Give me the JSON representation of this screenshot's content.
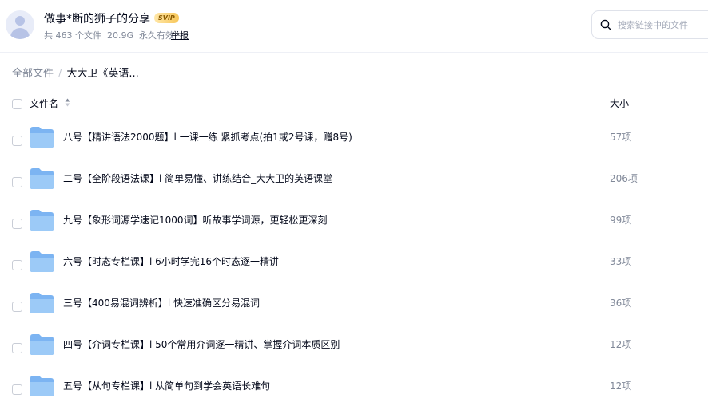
{
  "share": {
    "title": "做事*断的狮子的分享",
    "badge": "SVIP",
    "file_count": "共 463 个文件",
    "total_size": "20.9G",
    "validity": "永久有效",
    "report": "举报"
  },
  "search": {
    "placeholder": "搜索链接中的文件"
  },
  "breadcrumb": {
    "root": "全部文件",
    "separator": "/",
    "current": "大大卫《英语..."
  },
  "columns": {
    "name": "文件名",
    "size": "大小"
  },
  "files": [
    {
      "name": "八号【精讲语法2000题】l 一课一练 紧抓考点(拍1或2号课，赠8号)",
      "size": "57项"
    },
    {
      "name": "二号【全阶段语法课】l 简单易懂、讲练结合_大大卫的英语课堂",
      "size": "206项"
    },
    {
      "name": "九号【象形词源学速记1000词】听故事学词源，更轻松更深刻",
      "size": "99项"
    },
    {
      "name": "六号【时态专栏课】l 6小时学完16个时态逐一精讲",
      "size": "33项"
    },
    {
      "name": "三号【400易混词辨析】l 快速准确区分易混词",
      "size": "36项"
    },
    {
      "name": "四号【介词专栏课】l 50个常用介词逐一精讲、掌握介词本质区别",
      "size": "12项"
    },
    {
      "name": "五号【从句专栏课】l 从简单句到学会英语长难句",
      "size": "12项"
    }
  ],
  "icons": {
    "avatar": "avatar-icon",
    "search": "search-icon",
    "sort": "sort-icon",
    "folder": "folder-icon"
  },
  "colors": {
    "text": "#03081a",
    "secondary": "#818999",
    "folder": "#7cb4f2",
    "badge": "#f7c659"
  }
}
